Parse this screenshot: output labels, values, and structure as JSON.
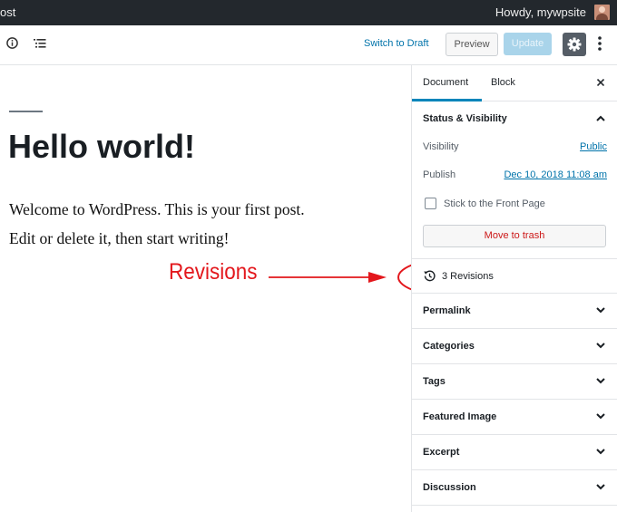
{
  "admin_bar": {
    "left_text": "ost",
    "greeting": "Howdy, mywpsite",
    "avatar_icon": "user-avatar"
  },
  "toolbar": {
    "info_icon": "info-icon",
    "outline_icon": "list-icon",
    "switch_draft": "Switch to Draft",
    "preview": "Preview",
    "update": "Update",
    "settings_icon": "gear-icon",
    "more_icon": "vertical-ellipsis-icon"
  },
  "editor": {
    "title": "Hello world!",
    "paragraphs": [
      "Welcome to WordPress. This is your first post.",
      "Edit or delete it, then start writing!"
    ]
  },
  "annotation": {
    "label": "Revisions",
    "color": "#e3171c"
  },
  "sidebar": {
    "tabs": {
      "document": "Document",
      "block": "Block"
    },
    "close_icon": "close-icon",
    "status": {
      "title": "Status & Visibility",
      "visibility_label": "Visibility",
      "visibility_value": "Public",
      "publish_label": "Publish",
      "publish_value": "Dec 10, 2018 11:08 am",
      "stick_label": "Stick to the Front Page",
      "stick_checked": false,
      "trash": "Move to trash"
    },
    "revisions": {
      "label": "3 Revisions",
      "icon": "history-icon"
    },
    "panels": [
      "Permalink",
      "Categories",
      "Tags",
      "Featured Image",
      "Excerpt",
      "Discussion"
    ]
  },
  "colors": {
    "accent": "#0073aa",
    "tab_underline": "#0085ba",
    "admin_bar": "#23282d",
    "trash": "#cc1818"
  }
}
